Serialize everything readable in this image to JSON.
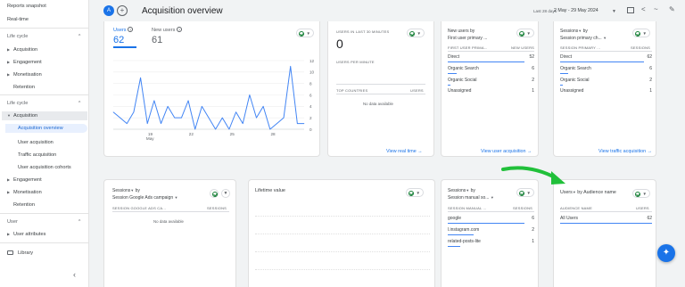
{
  "sidebar": {
    "top_items": [
      "Reports snapshot",
      "Real-time"
    ],
    "section1": {
      "title": "Life cycle",
      "items": [
        "Acquisition",
        "Engagement",
        "Monetisation",
        "Retention"
      ]
    },
    "section2": {
      "title": "Life cycle",
      "acquisition": "Acquisition",
      "sub": [
        "Acquisition overview",
        "User acquisition",
        "Traffic acquisition",
        "User acquisition cohorts"
      ],
      "items": [
        "Engagement",
        "Monetisation",
        "Retention"
      ]
    },
    "section3": {
      "title": "User",
      "items": [
        "User attributes"
      ]
    },
    "library": "Library"
  },
  "header": {
    "avatar": "A",
    "title": "Acquisition overview",
    "date_label": "Last 28 days",
    "date_range": "2 May - 29 May 2024"
  },
  "card1": {
    "m1_label": "Users",
    "m1_value": "62",
    "m2_label": "New users",
    "m2_value": "61",
    "x_ticks": [
      "19\nMay",
      "",
      ""
    ],
    "x_labels": [
      "19",
      "22",
      "25",
      "28"
    ],
    "x_month": "May",
    "y_ticks": [
      "12",
      "10",
      "8",
      "6",
      "4",
      "2",
      "0"
    ]
  },
  "card2": {
    "title": "USERS IN LAST 30 MINUTES",
    "value": "0",
    "sub": "USERS PER MINUTE",
    "col1": "TOP COUNTRIES",
    "col2": "USERS",
    "empty": "No data available",
    "link": "View real time"
  },
  "card3": {
    "title1": "New users by",
    "title2": "First user primary ...",
    "col1": "FIRST USER PRIMA...",
    "col2": "NEW USERS",
    "rows": [
      {
        "label": "Direct",
        "value": "52"
      },
      {
        "label": "Organic Search",
        "value": "6"
      },
      {
        "label": "Organic Social",
        "value": "2"
      },
      {
        "label": "Unassigned",
        "value": "1"
      }
    ],
    "link": "View user acquisition"
  },
  "card4": {
    "title1": "Sessions",
    "title2": "Session primary ch...",
    "col1": "SESSION PRIMARY ...",
    "col2": "SESSIONS",
    "rows": [
      {
        "label": "Direct",
        "value": "62"
      },
      {
        "label": "Organic Search",
        "value": "6"
      },
      {
        "label": "Organic Social",
        "value": "2"
      },
      {
        "label": "Unassigned",
        "value": "1"
      }
    ],
    "link": "View traffic acquisition"
  },
  "card5": {
    "title1": "Sessions",
    "title2": "Session Google Ads campaign",
    "col1": "SESSION GOOGLE ADS CA...",
    "col2": "SESSIONS",
    "empty": "No data available"
  },
  "card6": {
    "title": "Lifetime value"
  },
  "card7": {
    "title1": "Sessions",
    "title2": "Session manual so...",
    "col1": "SESSION MANUAL ...",
    "col2": "SESSIONS",
    "rows": [
      {
        "label": "google",
        "value": "6"
      },
      {
        "label": "l.instagram.com",
        "value": "2"
      },
      {
        "label": "related-posts-lite",
        "value": "1"
      }
    ]
  },
  "card8": {
    "title": "Users",
    "title2": "by Audience name",
    "col1": "AUDIENCE NAME",
    "col2": "USERS",
    "rows": [
      {
        "label": "All Users",
        "value": "62"
      }
    ]
  },
  "chart_data": {
    "type": "line",
    "series": [
      {
        "name": "Users",
        "values": [
          3,
          2,
          1,
          3,
          9,
          1,
          5,
          1,
          4,
          2,
          2,
          5,
          0,
          4,
          2,
          0,
          2,
          0,
          3,
          1,
          6,
          2,
          4,
          0,
          1,
          2,
          11,
          1,
          1
        ]
      }
    ],
    "ylim": [
      0,
      12
    ],
    "x_tick_labels": [
      "19",
      "22",
      "25",
      "28"
    ],
    "color": "#4285f4"
  }
}
